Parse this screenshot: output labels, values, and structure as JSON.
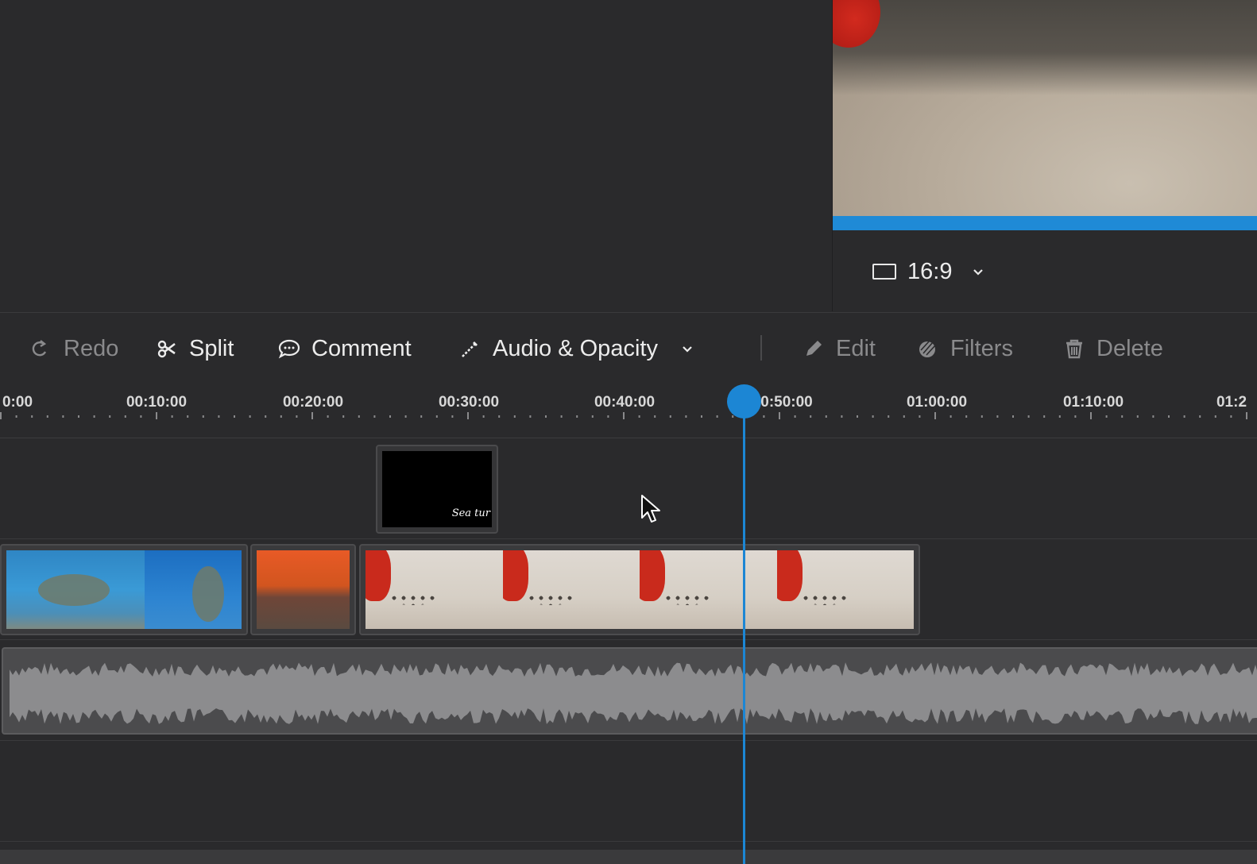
{
  "preview": {
    "aspect_ratio": "16:9"
  },
  "toolbar": {
    "redo_label": "Redo",
    "split_label": "Split",
    "comment_label": "Comment",
    "audio_opacity_label": "Audio & Opacity",
    "edit_label": "Edit",
    "filters_label": "Filters",
    "delete_label": "Delete"
  },
  "ruler": {
    "ticks": [
      "0:00",
      "00:10:00",
      "00:20:00",
      "00:30:00",
      "00:40:00",
      "0:50:00",
      "01:00:00",
      "01:10:00",
      "01:2"
    ]
  },
  "tracks": {
    "title_clip_text": "Sea tur"
  },
  "colors": {
    "accent": "#1c86d4",
    "background": "#2a2a2c",
    "text_dim": "#8a8a8c",
    "text_bright": "#ececec"
  },
  "icons": {
    "redo": "redo-arrow",
    "split": "scissors",
    "comment": "speech-bubble",
    "audio_opacity": "wand",
    "edit": "pencil",
    "filters": "filter-drop",
    "delete": "trash-can",
    "aspect": "rectangle",
    "dropdown": "chevron-down"
  }
}
